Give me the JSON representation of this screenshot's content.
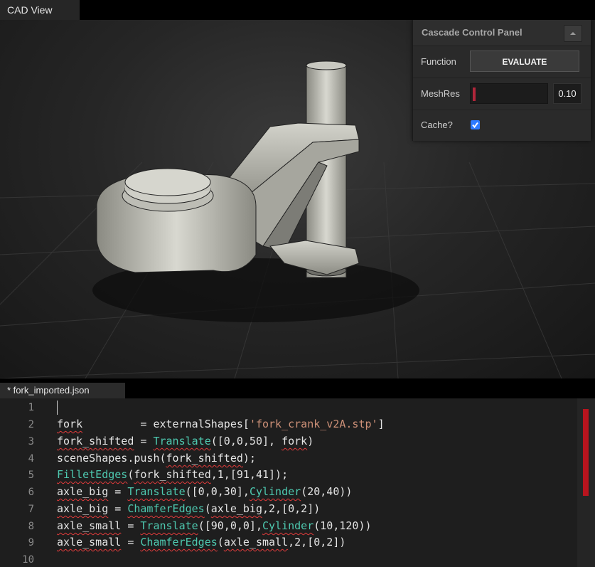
{
  "window": {
    "cad_tab": "CAD View",
    "file_tab": "* fork_imported.json"
  },
  "panel": {
    "title": "Cascade Control Panel",
    "function_label": "Function",
    "evaluate_label": "EVALUATE",
    "meshres_label": "MeshRes",
    "meshres_value": "0.10",
    "meshres_fraction": 0.1,
    "cache_label": "Cache?",
    "cache_checked": true
  },
  "editor": {
    "line_numbers": [
      "1",
      "2",
      "3",
      "4",
      "5",
      "6",
      "7",
      "8",
      "9",
      "10"
    ],
    "lines": [
      "",
      "fork         = externalShapes['fork_crank_v2A.stp']",
      "fork_shifted = Translate([0,0,50], fork)",
      "sceneShapes.push(fork_shifted);",
      "FilletEdges(fork_shifted,1,[91,41]);",
      "axle_big = Translate([0,0,30],Cylinder(20,40))",
      "axle_big = ChamferEdges(axle_big,2,[0,2])",
      "axle_small = Translate([90,0,0],Cylinder(10,120))",
      "axle_small = ChamferEdges(axle_small,2,[0,2])",
      ""
    ]
  },
  "colors": {
    "accent": "#2e7bff",
    "slider": "#b0263a",
    "function": "#4ec9b0",
    "string": "#ce9178",
    "error": "#e23b3b"
  },
  "icons": {
    "collapse": "chevron-up-icon",
    "cache": "checkbox-icon"
  }
}
